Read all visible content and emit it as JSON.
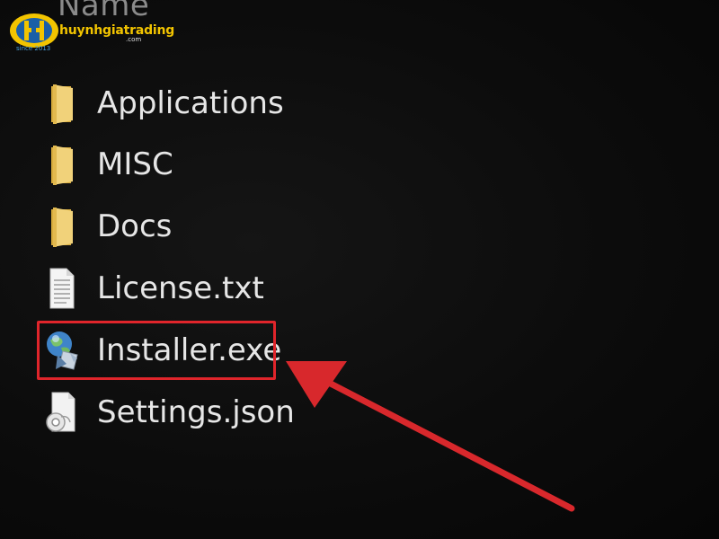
{
  "explorer": {
    "column_header": "Name",
    "files": [
      {
        "name": "Applications",
        "icon": "folder-icon"
      },
      {
        "name": "MISC",
        "icon": "folder-icon"
      },
      {
        "name": "Docs",
        "icon": "folder-icon"
      },
      {
        "name": "License.txt",
        "icon": "text-file-icon"
      },
      {
        "name": "Installer.exe",
        "icon": "installer-exe-icon"
      },
      {
        "name": "Settings.json",
        "icon": "json-file-icon"
      }
    ],
    "highlighted_item": "Installer.exe"
  },
  "watermark": {
    "brand": "huynhgiatrading",
    "domain_suffix": ".com",
    "since": "since 2013"
  },
  "colors": {
    "background": "#0b0b0b",
    "text": "#e6e6e6",
    "folder": "#e8c660",
    "highlight": "#e0252b",
    "arrow": "#d8282c",
    "brand_yellow": "#f2c400",
    "brand_blue": "#1a5fa8"
  }
}
